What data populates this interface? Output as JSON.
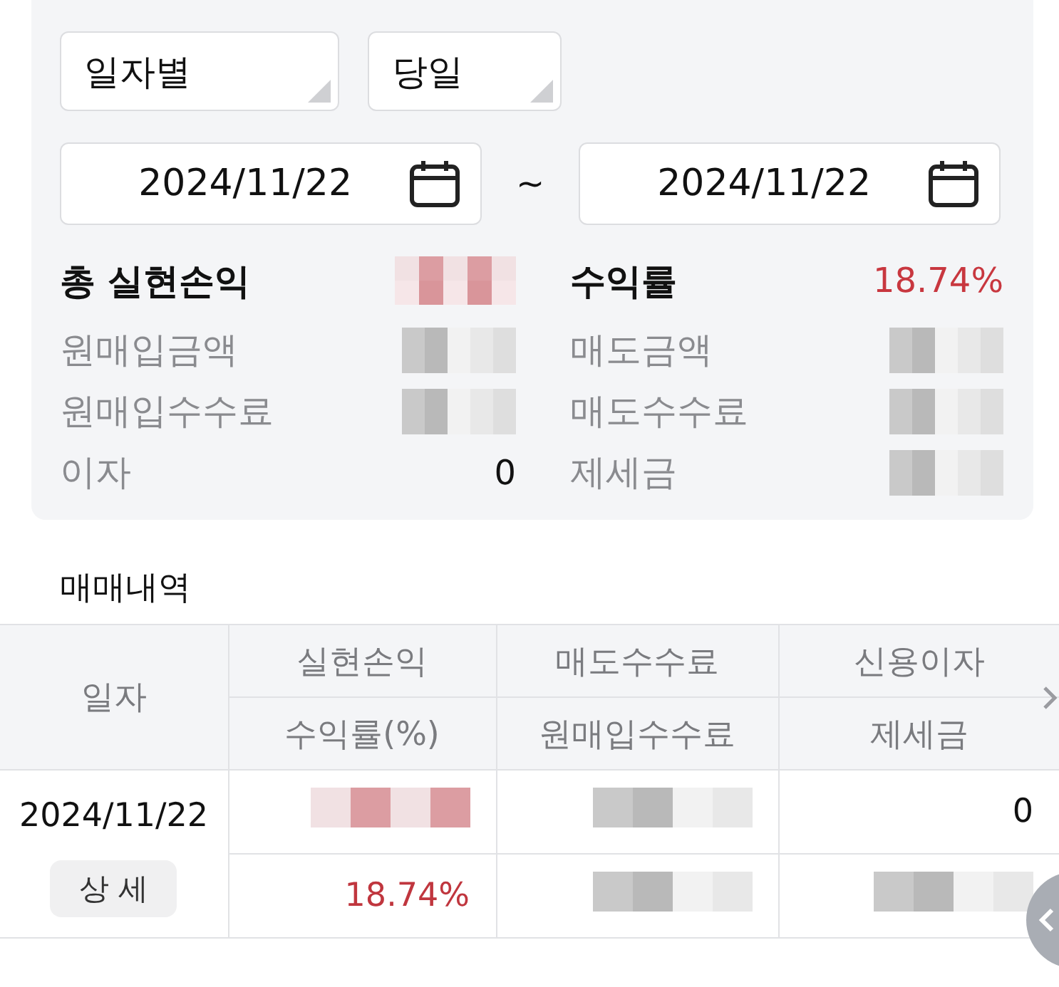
{
  "filters": {
    "dropdowns": [
      {
        "value": "일자별"
      },
      {
        "value": "당일"
      }
    ],
    "date_from": "2024/11/22",
    "separator": "~",
    "date_to": "2024/11/22"
  },
  "summary": {
    "left": [
      {
        "kind": "total",
        "label": "총 실현손익",
        "redacted": true
      },
      {
        "kind": "detail",
        "label": "원매입금액",
        "redacted": true
      },
      {
        "kind": "detail",
        "label": "원매입수수료",
        "redacted": true
      },
      {
        "kind": "detail",
        "label": "이자",
        "value": "0"
      }
    ],
    "right": [
      {
        "kind": "total",
        "label": "수익률",
        "value": "18.74%"
      },
      {
        "kind": "detail",
        "label": "매도금액",
        "redacted": true
      },
      {
        "kind": "detail",
        "label": "매도수수료",
        "redacted": true
      },
      {
        "kind": "detail",
        "label": "제세금",
        "redacted": true
      }
    ]
  },
  "trades": {
    "title": "매매내역",
    "date_header": "일자",
    "header_top": [
      "실현손익",
      "매도수수료",
      "신용이자"
    ],
    "header_bottom": [
      "수익률(%)",
      "원매입수수료",
      "제세금"
    ],
    "rows": [
      {
        "date": "2024/11/22",
        "detail_button": "상 세",
        "top": [
          {
            "kind": "gainmask"
          },
          {
            "kind": "mask"
          },
          {
            "kind": "plain",
            "value": "0"
          }
        ],
        "bottom": [
          {
            "kind": "gain",
            "value": "18.74%"
          },
          {
            "kind": "mask"
          },
          {
            "kind": "mask"
          }
        ]
      }
    ]
  }
}
